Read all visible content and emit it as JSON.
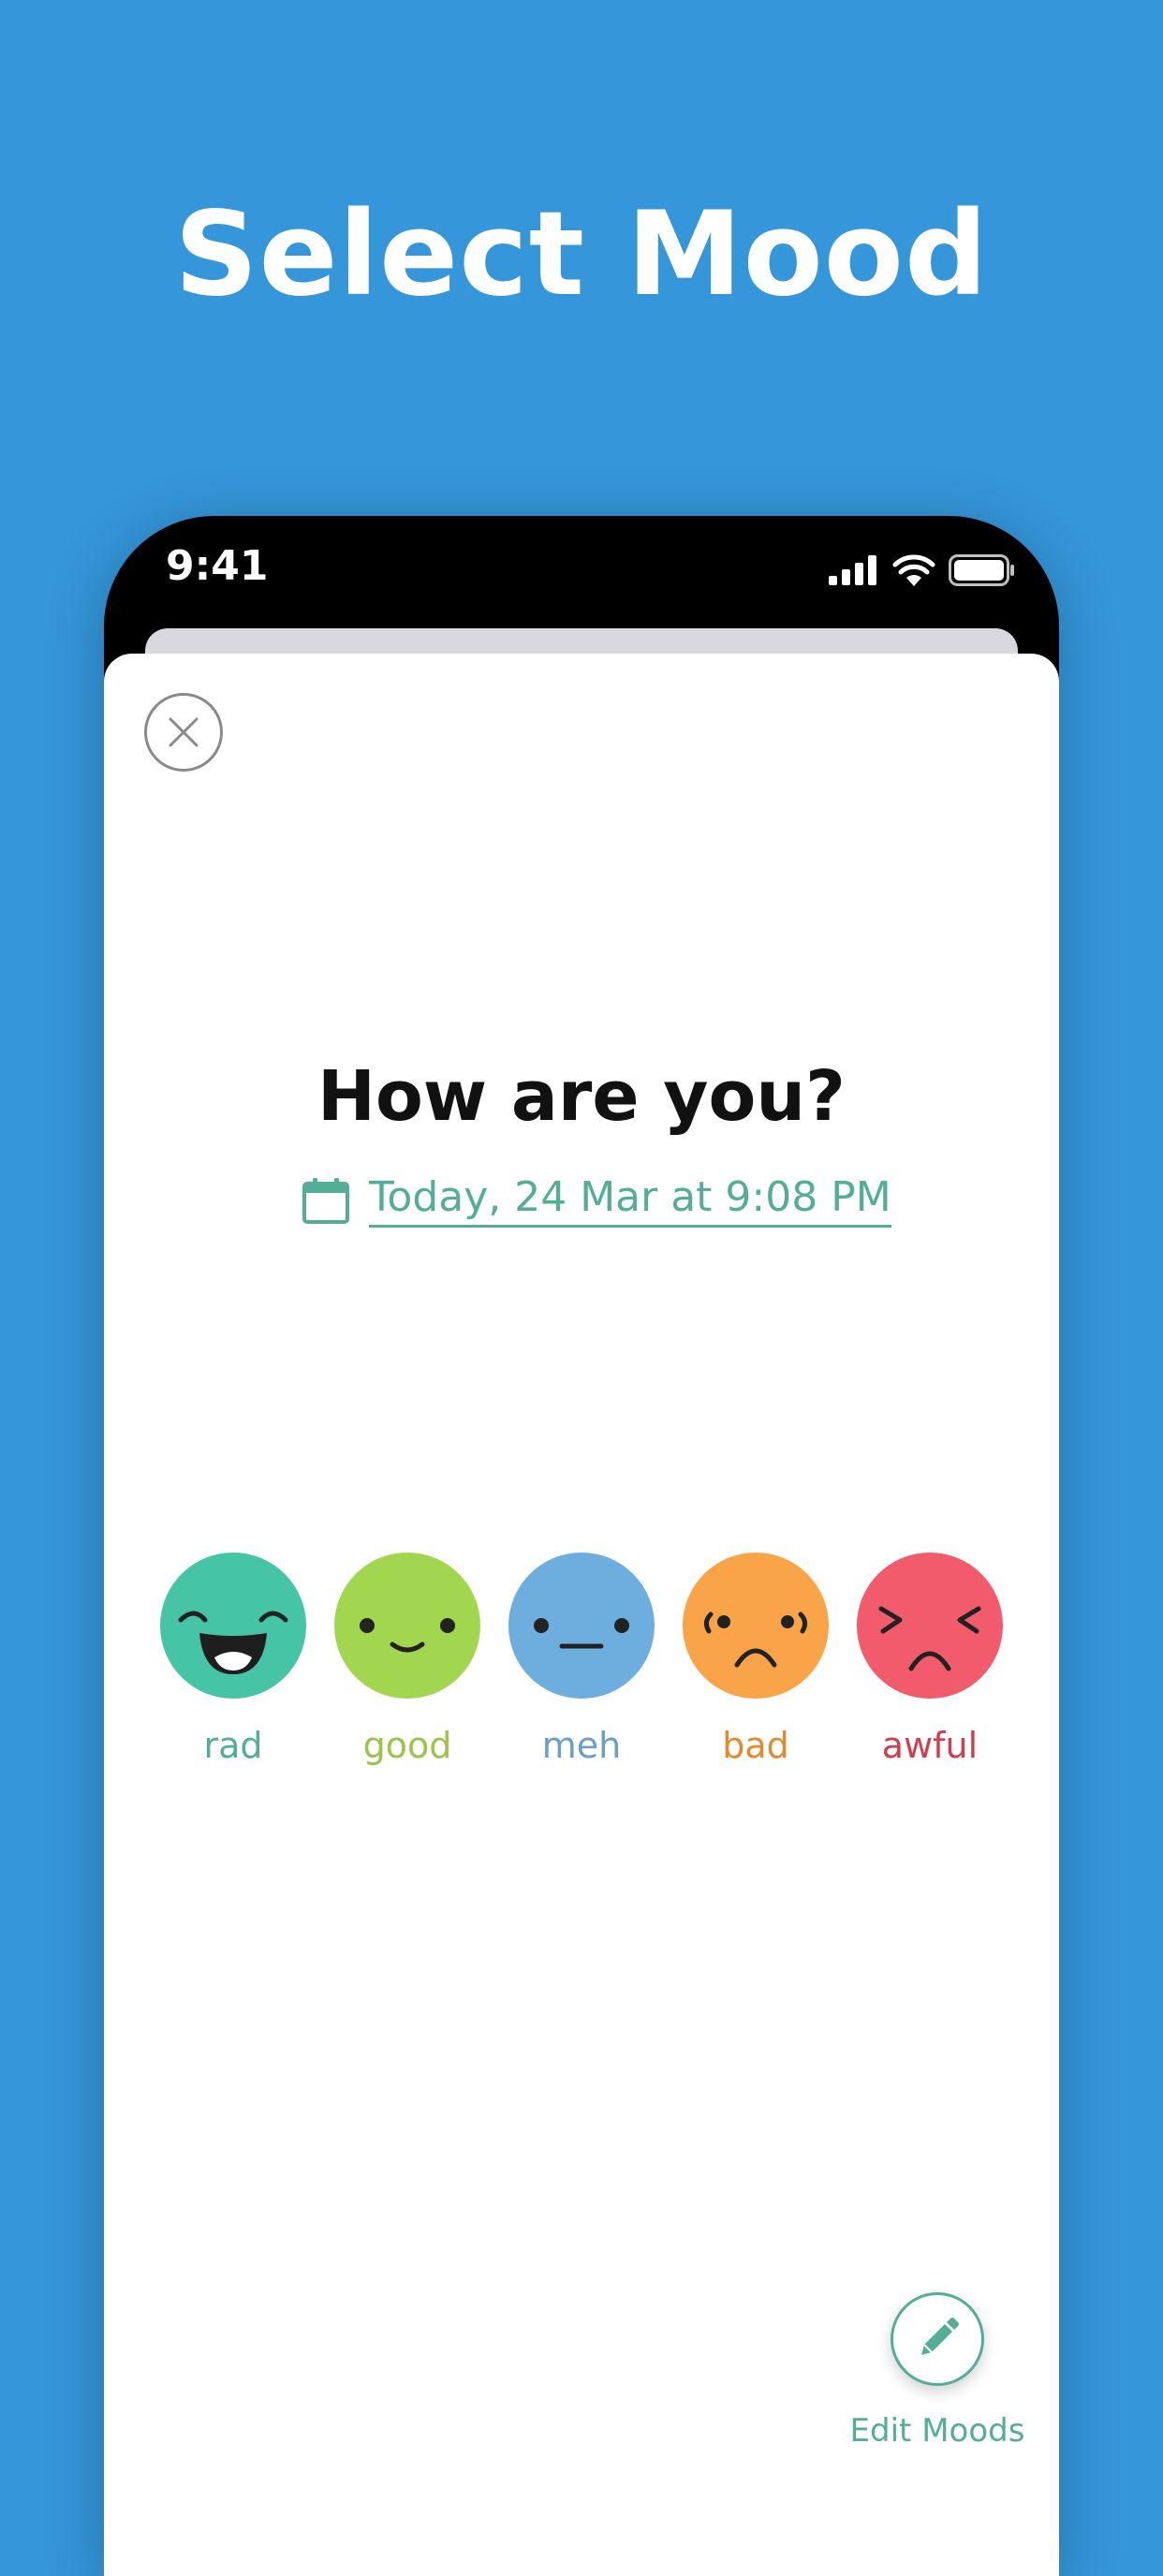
{
  "headline": "Select Mood",
  "status_bar": {
    "time": "9:41",
    "icons": [
      "signal-icon",
      "wifi-icon",
      "battery-icon"
    ]
  },
  "sheet": {
    "close_icon": "close-icon",
    "question": "How are you?",
    "date_icon": "calendar-icon",
    "date_text": "Today, 24 Mar at 9:08 PM"
  },
  "moods": [
    {
      "label": "rad",
      "color": "#45C4A6",
      "label_color": "#53AE95"
    },
    {
      "label": "good",
      "color": "#A1D64E",
      "label_color": "#9BC44A"
    },
    {
      "label": "meh",
      "color": "#6DAEDE",
      "label_color": "#6A9FC6"
    },
    {
      "label": "bad",
      "color": "#FAA44A",
      "label_color": "#E48A2E"
    },
    {
      "label": "awful",
      "color": "#F15B6B",
      "label_color": "#D23D4E"
    }
  ],
  "edit": {
    "icon": "pencil-icon",
    "label": "Edit Moods"
  },
  "colors": {
    "background": "#3596DA",
    "accent": "#53AE95"
  }
}
